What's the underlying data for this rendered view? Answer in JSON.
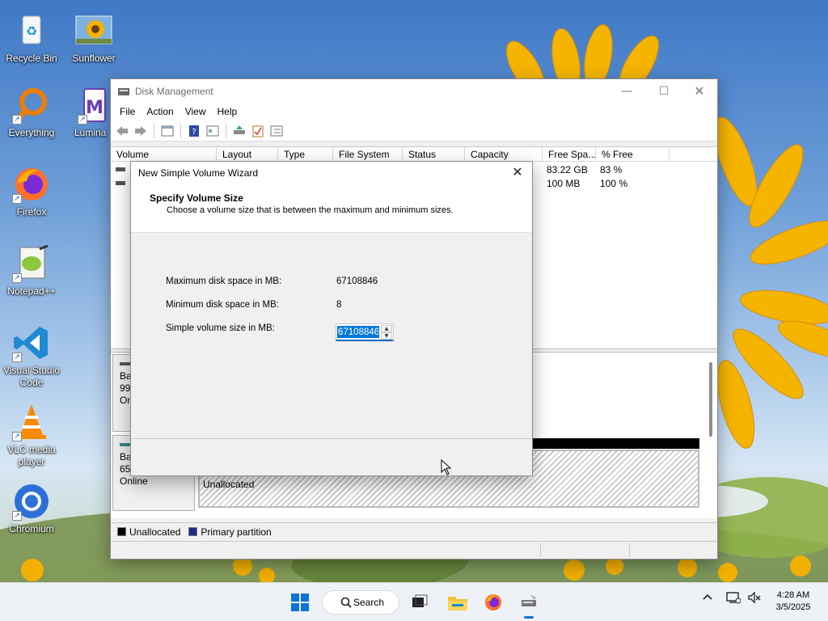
{
  "desktop": {
    "icons": [
      {
        "label": "Recycle Bin",
        "icon": "recycle-bin-icon"
      },
      {
        "label": "Sunflower",
        "icon": "image-file-icon"
      },
      {
        "label": "Everything",
        "icon": "everything-search-icon"
      },
      {
        "label": "Lumina",
        "icon": "lumina-app-icon"
      },
      {
        "label": "Firefox",
        "icon": "firefox-icon"
      },
      {
        "label": "Notepad++",
        "icon": "notepad-plus-plus-icon"
      },
      {
        "label": "Visual Studio Code",
        "icon": "vscode-icon"
      },
      {
        "label": "VLC media player",
        "icon": "vlc-icon"
      },
      {
        "label": "Chromium",
        "icon": "chromium-icon"
      }
    ]
  },
  "window": {
    "title": "Disk Management",
    "menu": [
      "File",
      "Action",
      "View",
      "Help"
    ],
    "columns": [
      "Volume",
      "Layout",
      "Type",
      "File System",
      "Status",
      "Capacity",
      "Free Spa...",
      "% Free"
    ],
    "rows": [
      {
        "free": "83.22 GB",
        "pct_free": "83 %"
      },
      {
        "free": "100 MB",
        "pct_free": "100 %"
      }
    ],
    "disks": [
      {
        "line1": "Ba",
        "line2": "99.",
        "line3": "Onl"
      },
      {
        "line1": "Ba",
        "line2": "655",
        "line3": "Online"
      }
    ],
    "unallocated_label": "Unallocated",
    "legend": [
      {
        "label": "Unallocated",
        "color": "#000000"
      },
      {
        "label": "Primary partition",
        "color": "#1f2a8a"
      }
    ]
  },
  "wizard": {
    "title": "New Simple Volume Wizard",
    "heading": "Specify Volume Size",
    "subheading": "Choose a volume size that is between the maximum and minimum sizes.",
    "max_label": "Maximum disk space in MB:",
    "max_value": "67108846",
    "min_label": "Minimum disk space in MB:",
    "min_value": "8",
    "size_label": "Simple volume size in MB:",
    "size_value": "67108846"
  },
  "taskbar": {
    "search_label": "Search",
    "time": "4:28 AM",
    "date": "3/5/2025"
  },
  "colors": {
    "accent": "#0078d7",
    "taskbar": "#eef1f5"
  }
}
